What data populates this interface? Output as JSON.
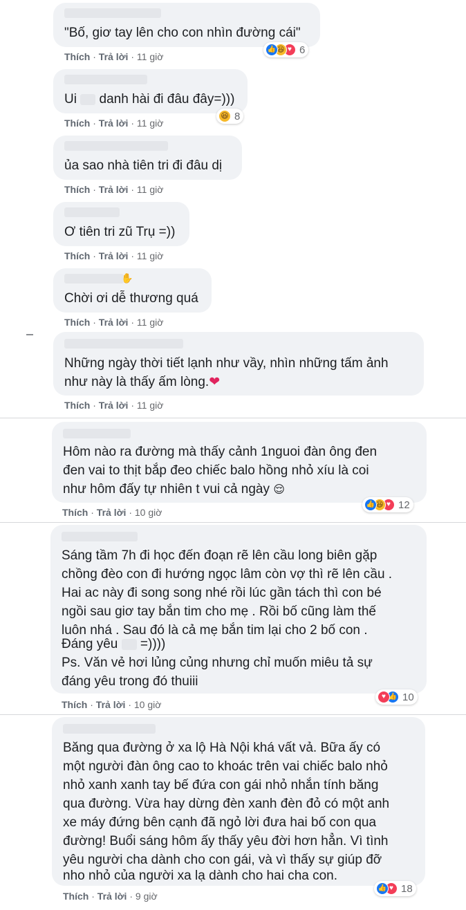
{
  "actions": {
    "like": "Thích",
    "reply": "Trả lời",
    "sep": "·"
  },
  "comments": [
    {
      "lines": [
        "\"Bố, giơ tay lên cho con nhìn đường cái\""
      ],
      "time": "11 giờ",
      "reactions": [
        "like",
        "haha",
        "love"
      ],
      "count": "6"
    },
    {
      "line_before": "Ui",
      "line_after": "danh hài đi đâu đây=)))",
      "time": "11 giờ",
      "reactions": [
        "haha"
      ],
      "count": "8"
    },
    {
      "lines": [
        "ủa sao nhà tiên tri đi đâu dị"
      ],
      "time": "11 giờ"
    },
    {
      "lines": [
        "Ơ tiên tri zũ Trụ =))"
      ],
      "time": "11 giờ"
    },
    {
      "lines": [
        "Chời ơi dễ thương quá"
      ],
      "time": "11 giờ"
    },
    {
      "lines": [
        "Những ngày thời tiết lạnh như vầy, nhìn những tấm ảnh",
        "như này là thấy ấm lòng."
      ],
      "heart": "❤",
      "time": "11 giờ"
    },
    {
      "lines": [
        "Hôm nào ra đường mà thấy cảnh 1nguoi đàn ông đen",
        "đen vai to thịt bắp đeo chiếc balo hồng nhỏ xíu là coi",
        "như hôm đấy tự nhiên t vui cả ngày"
      ],
      "emoji": "😌",
      "time": "10 giờ",
      "reactions": [
        "like",
        "haha",
        "love"
      ],
      "count": "12"
    },
    {
      "lines": [
        "Sáng tầm 7h đi học đến đoạn rẽ lên cầu long biên gặp",
        "chồng đèo con đi hướng ngọc lâm còn vợ thì rẽ lên cầu .",
        "Hai ac này đi song song nhé rồi lúc gần tách thì con bé",
        "ngồi sau giơ tay bắn tim cho mẹ . Rồi bố cũng làm thế",
        "luôn nhá . Sau đó là cả mẹ bắn tim lại cho 2 bố con ."
      ],
      "line6_before": "Đáng yêu",
      "line6_after": "=))))",
      "lines_tail": [
        "Ps. Văn vẻ hơi lủng củng nhưng chỉ muốn miêu tả sự",
        "đáng yêu trong đó thuiii"
      ],
      "time": "10 giờ",
      "reactions": [
        "love",
        "like"
      ],
      "count": "10"
    },
    {
      "lines": [
        "Băng qua đường ở xa lộ Hà Nội khá vất vả. Bữa ấy có",
        "một người đàn ông cao to khoác trên vai chiếc balo nhỏ",
        "nhỏ xanh xanh tay bế đứa con gái nhỏ nhắn tính băng",
        "qua đường. Vừa hay dừng đèn xanh đèn đỏ có một anh",
        "xe máy đứng bên cạnh đã ngỏ lời đưa hai bố con qua",
        "đường! Buổi sáng hôm ấy thấy yêu đời hơn hẳn. Vì tình",
        "yêu người cha dành cho con gái, và vì thấy sự giúp đỡ",
        "nho nhỏ của người xa lạ dành cho hai cha con."
      ],
      "time": "9 giờ",
      "reactions": [
        "like",
        "love"
      ],
      "count": "18"
    }
  ],
  "icons": {
    "like": "thumbs-up",
    "haha": "laughing-face",
    "love": "heart",
    "wave": "waving-hand"
  },
  "colors": {
    "bubble": "#f0f2f5",
    "like": "#1877f2",
    "love": "#f33e58",
    "haha": "#f7b928",
    "meta": "#65676b"
  }
}
